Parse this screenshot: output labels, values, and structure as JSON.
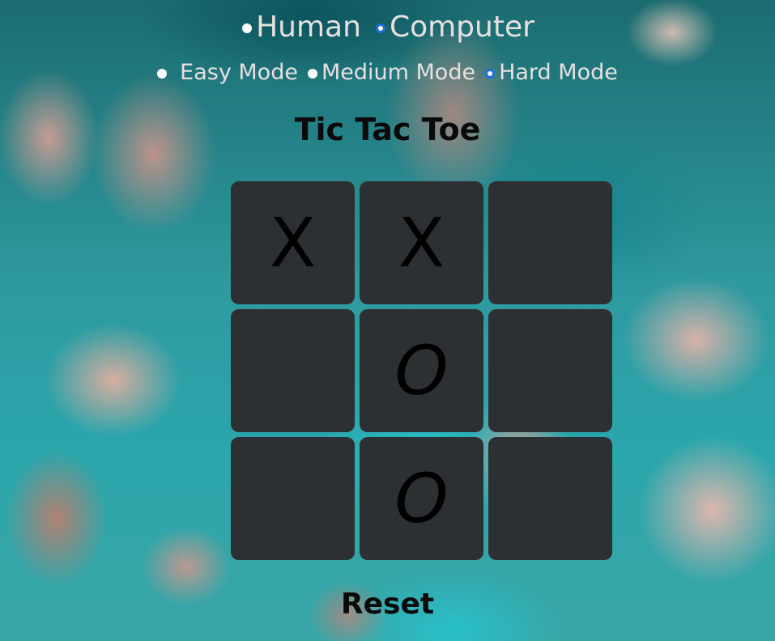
{
  "players": {
    "options": [
      {
        "label": "Human",
        "selected": false
      },
      {
        "label": "Computer",
        "selected": true
      }
    ]
  },
  "modes": {
    "options": [
      {
        "label": "Easy Mode",
        "selected": false
      },
      {
        "label": "Medium Mode",
        "selected": false
      },
      {
        "label": "Hard Mode",
        "selected": true
      }
    ]
  },
  "title": "Tic Tac Toe",
  "board": {
    "cells": [
      "X",
      "X",
      "",
      "",
      "O",
      "",
      "",
      "O",
      ""
    ]
  },
  "reset_label": "Reset",
  "colors": {
    "cell_bg": "#2d3033",
    "mark": "#000000",
    "radio_selected": "#1f6fe0",
    "option_text": "#e8e0e0"
  }
}
